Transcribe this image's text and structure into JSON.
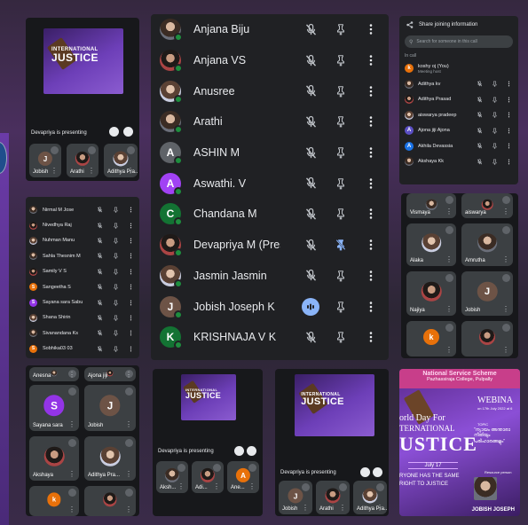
{
  "main_list": {
    "people": [
      {
        "name": "Anjana Biju",
        "initial": "",
        "color": "",
        "photo": "photo",
        "speaking": false,
        "pin_off": false
      },
      {
        "name": "Anjana VS",
        "initial": "",
        "color": "",
        "photo": "photo2",
        "speaking": false,
        "pin_off": false
      },
      {
        "name": "Anusree",
        "initial": "",
        "color": "",
        "photo": "photo3",
        "speaking": false,
        "pin_off": false
      },
      {
        "name": "Arathi",
        "initial": "",
        "color": "",
        "photo": "photo",
        "speaking": false,
        "pin_off": false
      },
      {
        "name": "ASHIN M",
        "initial": "A",
        "color": "#5f6368",
        "photo": "",
        "speaking": false,
        "pin_off": false
      },
      {
        "name": "Aswathi. V",
        "initial": "A",
        "color": "#a142f4",
        "photo": "",
        "speaking": false,
        "pin_off": false
      },
      {
        "name": "Chandana M",
        "initial": "C",
        "color": "#137333",
        "photo": "",
        "speaking": false,
        "pin_off": false
      },
      {
        "name": "Devapriya M (Pres...",
        "initial": "",
        "color": "",
        "photo": "photo2",
        "speaking": false,
        "pin_off": true
      },
      {
        "name": "Jasmin Jasmin",
        "initial": "",
        "color": "",
        "photo": "photo3",
        "speaking": false,
        "pin_off": false
      },
      {
        "name": "Jobish Joseph K",
        "initial": "J",
        "color": "#6d5346",
        "photo": "",
        "speaking": true,
        "pin_off": false
      },
      {
        "name": "KRISHNAJA V K",
        "initial": "K",
        "color": "#137333",
        "photo": "",
        "speaking": false,
        "pin_off": false
      }
    ]
  },
  "people_panel": {
    "share_label": "Share joining information",
    "search_placeholder": "Search for someone in this call",
    "in_call_label": "In call",
    "host": {
      "name": "koshy oj (You)",
      "role": "Meeting host"
    },
    "people": [
      {
        "name": "Adithya kv",
        "initial": "",
        "color": "",
        "photo": "photo"
      },
      {
        "name": "Adithya Prasad",
        "initial": "",
        "color": "",
        "photo": "photo2"
      },
      {
        "name": "aiswarya pradeep",
        "initial": "",
        "color": "",
        "photo": "photo3"
      },
      {
        "name": "Ajona jiji Ajona",
        "initial": "A",
        "color": "#5b4fc4",
        "photo": ""
      },
      {
        "name": "Akhila Devassia",
        "initial": "A",
        "color": "#1a73e8",
        "photo": ""
      },
      {
        "name": "Akshaya Kk",
        "initial": "",
        "color": "",
        "photo": "photo"
      }
    ]
  },
  "left_list": {
    "people": [
      {
        "name": "Nirmal M Jose",
        "initial": "",
        "color": "",
        "photo": "photo"
      },
      {
        "name": "Nivedhya Raj",
        "initial": "",
        "color": "",
        "photo": "photo2"
      },
      {
        "name": "Nuhman Manu",
        "initial": "",
        "color": "",
        "photo": "photo3"
      },
      {
        "name": "Sahla Thesnim M",
        "initial": "",
        "color": "",
        "photo": "photo"
      },
      {
        "name": "Samily V S",
        "initial": "",
        "color": "",
        "photo": "photo2"
      },
      {
        "name": "Sangeetha S",
        "initial": "S",
        "color": "#e8710a",
        "photo": ""
      },
      {
        "name": "Sayana sara Sabu",
        "initial": "S",
        "color": "#9334e6",
        "photo": ""
      },
      {
        "name": "Shana Shirin",
        "initial": "",
        "color": "",
        "photo": "photo3"
      },
      {
        "name": "Sivanandana Ks",
        "initial": "",
        "color": "",
        "photo": "photo"
      },
      {
        "name": "Sobhika03 03",
        "initial": "S",
        "color": "#e8710a",
        "photo": ""
      }
    ]
  },
  "topleft": {
    "presenting": "Devapriya is presenting",
    "slide_title_1": "INTERNATIONAL",
    "slide_title_2": "JUSTICE",
    "tiles": [
      {
        "name": "Jobish",
        "initial": "J"
      },
      {
        "name": "Arathi",
        "initial": ""
      },
      {
        "name": "Adithya Pra...",
        "initial": ""
      }
    ]
  },
  "right_grid": {
    "tiles": [
      {
        "name": "Vismaya",
        "initial": ""
      },
      {
        "name": "aiswarya",
        "initial": ""
      },
      {
        "name": "Alaka",
        "initial": ""
      },
      {
        "name": "Amrutha",
        "initial": ""
      },
      {
        "name": "Najiya",
        "initial": ""
      },
      {
        "name": "Jobish",
        "initial": "J"
      },
      {
        "name": "",
        "initial": "k"
      },
      {
        "name": "",
        "initial": ""
      }
    ]
  },
  "bottom_left": {
    "tiles": [
      {
        "name": "Anesna",
        "initial": ""
      },
      {
        "name": "Ajona jiji",
        "initial": ""
      },
      {
        "name": "Sayana sara",
        "initial": "S"
      },
      {
        "name": "Jobish",
        "initial": "J"
      },
      {
        "name": "Akshaya",
        "initial": ""
      },
      {
        "name": "Adithya Pra...",
        "initial": ""
      },
      {
        "name": "",
        "initial": "k"
      },
      {
        "name": "",
        "initial": ""
      }
    ]
  },
  "bottom_mid": {
    "presenting": "Devapriya is presenting",
    "slide_title_1": "INTERNATIONAL",
    "slide_title_2": "JUSTICE",
    "tiles": [
      {
        "name": "Aksh...",
        "initial": ""
      },
      {
        "name": "Adi...",
        "initial": ""
      },
      {
        "name": "Ane...",
        "initial": "A"
      }
    ]
  },
  "bottom_mid2": {
    "presenting": "Devapriya is presenting",
    "slide_title_1": "INTERNATIONAL",
    "slide_title_2": "JUSTICE",
    "tiles": [
      {
        "name": "Jobish",
        "initial": "J"
      },
      {
        "name": "Arathi",
        "initial": ""
      },
      {
        "name": "Adithya Pra...",
        "initial": ""
      }
    ]
  },
  "poster": {
    "org_line1": "National Service Scheme",
    "org_line2": "Pazhassiraja College, Pulpally",
    "webinar": "WEBINA",
    "date": "on 17th July 2022 at 6",
    "title1": "orld Day For",
    "title2": "TERNATIONAL",
    "title3": "USTICE",
    "topic_label": "TOPIC",
    "topic": "\"ന്യായം അന്താരാ നീതിയും പരിഹാരങ്ങളും\"",
    "date_banner": "July 17",
    "slogan1": "RYONE HAS THE SAME",
    "slogan2": "RIGHT TO JUSTICE",
    "resource_label": "Resource person",
    "speaker": "JOBISH JOSEPH"
  }
}
